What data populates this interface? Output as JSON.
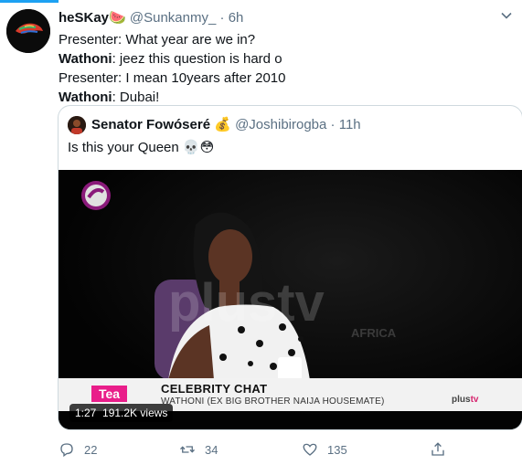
{
  "tweet": {
    "author_name": "heSKay",
    "author_emoji": "🍉",
    "handle": "@Sunkanmy_",
    "separator": "·",
    "time": "6h",
    "lines": [
      {
        "speaker": "",
        "text": "Presenter: What year are we in?"
      },
      {
        "speaker": "Wathoni",
        "text": ": jeez this question is hard o"
      },
      {
        "speaker": "",
        "text": "Presenter: I mean 10years after 2010"
      },
      {
        "speaker": "Wathoni",
        "text": ": Dubai!"
      }
    ]
  },
  "quoted": {
    "author_name": "Senator Fowóseré",
    "author_emoji": "💰",
    "handle": "@Joshibirogba",
    "separator": "·",
    "time": "11h",
    "text": "Is this your Queen",
    "text_emojis": "💀😳",
    "video": {
      "duration": "1:27",
      "views": "191.2K views",
      "watermark": "plustv",
      "watermark_sub": "AFRICA",
      "lower_third_tag": "Tea",
      "lower_third_title": "CELEBRITY CHAT",
      "lower_third_subtitle": "WATHONI (EX BIG BROTHER NAIJA HOUSEMATE)",
      "lower_third_brand_a": "plus",
      "lower_third_brand_b": "tv"
    }
  },
  "actions": {
    "reply_count": "22",
    "retweet_count": "34",
    "like_count": "135"
  },
  "colors": {
    "accent": "#1da1f2",
    "muted": "#5b7083",
    "brand_pink": "#d6246e"
  }
}
